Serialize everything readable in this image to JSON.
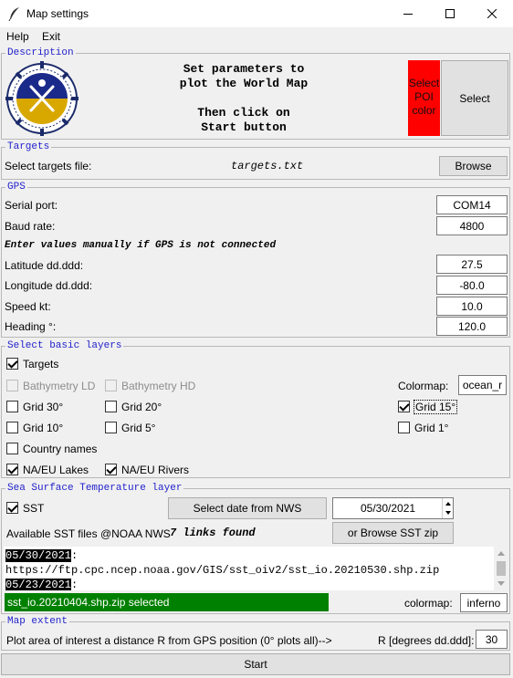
{
  "window": {
    "title": "Map settings"
  },
  "menu": {
    "help": "Help",
    "exit": "Exit"
  },
  "description": {
    "title": "Description",
    "line1": "Set parameters to",
    "line2": "plot the World Map",
    "line3": "Then click on",
    "line4": "Start button",
    "poi_line1": "Select",
    "poi_line2": "POI",
    "poi_line3": "color",
    "poi_color": "#ff0000",
    "select_button": "Select"
  },
  "targets": {
    "title": "Targets",
    "label": "Select targets file:",
    "filename": "targets.txt",
    "browse_button": "Browse"
  },
  "gps": {
    "title": "GPS",
    "serial_port_label": "Serial port:",
    "serial_port_value": "COM14",
    "baud_rate_label": "Baud rate:",
    "baud_rate_value": "4800",
    "manual_note": "Enter values manually if GPS is not connected",
    "latitude_label": "Latitude dd.ddd:",
    "latitude_value": "27.5",
    "longitude_label": "Longitude dd.ddd:",
    "longitude_value": "-80.0",
    "speed_label": "Speed kt:",
    "speed_value": "10.0",
    "heading_label": "Heading °:",
    "heading_value": "120.0"
  },
  "layers": {
    "title": "Select basic layers",
    "targets": "Targets",
    "bathy_ld": "Bathymetry LD",
    "bathy_hd": "Bathymetry HD",
    "colormap_label": "Colormap:",
    "colormap_value": "ocean_r",
    "grid30": "Grid 30°",
    "grid20": "Grid 20°",
    "grid15": "Grid 15°",
    "grid10": "Grid 10°",
    "grid5": "Grid 5°",
    "grid1": "Grid 1°",
    "country_names": "Country names",
    "lakes": "NA/EU Lakes",
    "rivers": "NA/EU Rivers"
  },
  "sst": {
    "title": "Sea Surface Temperature layer",
    "checkbox": "SST",
    "select_date_button": "Select date from NWS",
    "date_value": "05/30/2021",
    "available_label": "Available SST files @NOAA NWS",
    "links_found": "7 links found",
    "browse_zip_button": "or Browse SST zip",
    "list_date1": "05/30/2021",
    "list_colon1": ":",
    "list_url1": "https://ftp.cpc.ncep.noaa.gov/GIS/sst_oiv2/sst_io.20210530.shp.zip",
    "list_date2": "05/23/2021",
    "list_colon2": ":",
    "selected_status": "sst_io.20210404.shp.zip selected",
    "status_color": "#008000",
    "colormap_label": "colormap:",
    "colormap_value": "inferno"
  },
  "extent": {
    "title": "Map extent",
    "description": "Plot area of interest a distance R from GPS position (0° plots all)-->",
    "r_label": "R [degrees dd.ddd]:",
    "r_value": "30"
  },
  "start_button": "Start"
}
